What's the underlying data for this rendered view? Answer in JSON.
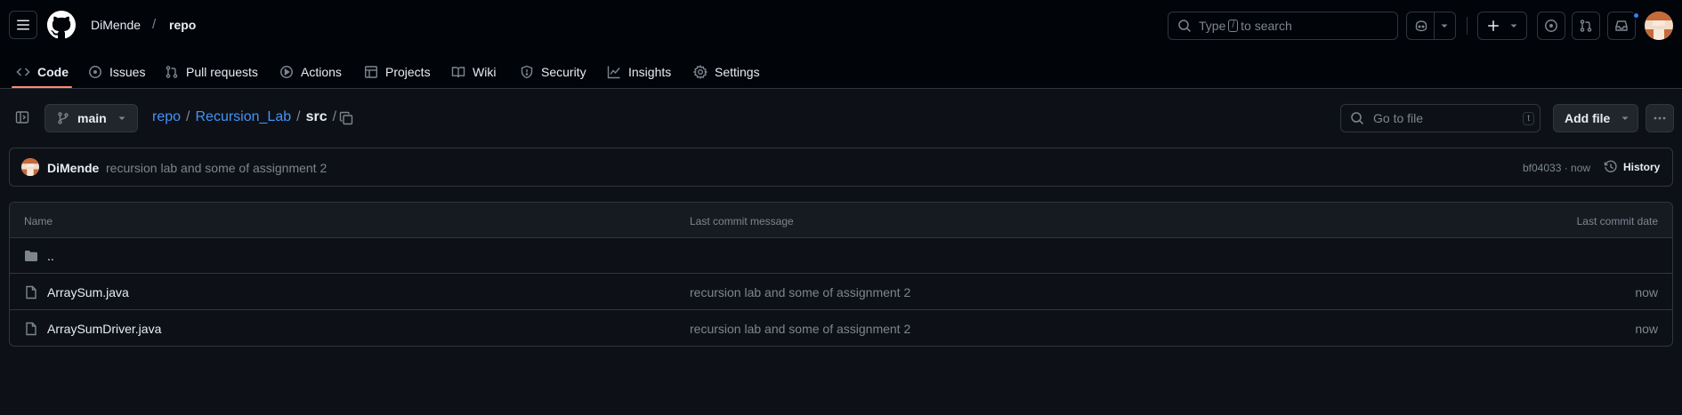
{
  "header": {
    "owner": "DiMende",
    "separator": "/",
    "repo": "repo",
    "search_prefix": "Type",
    "search_key": "/",
    "search_suffix": "to search"
  },
  "tabs": [
    {
      "label": "Code",
      "icon": "code-icon",
      "active": true
    },
    {
      "label": "Issues",
      "icon": "issue-icon"
    },
    {
      "label": "Pull requests",
      "icon": "pull-request-icon"
    },
    {
      "label": "Actions",
      "icon": "play-icon"
    },
    {
      "label": "Projects",
      "icon": "table-icon"
    },
    {
      "label": "Wiki",
      "icon": "book-icon"
    },
    {
      "label": "Security",
      "icon": "shield-icon"
    },
    {
      "label": "Insights",
      "icon": "graph-icon"
    },
    {
      "label": "Settings",
      "icon": "gear-icon"
    }
  ],
  "toolbar": {
    "branch": "main",
    "breadcrumb": {
      "root": "repo",
      "folder": "Recursion_Lab",
      "current": "src",
      "sep": "/"
    },
    "goto_placeholder": "Go to file",
    "goto_key": "t",
    "add_file": "Add file"
  },
  "commit": {
    "author": "DiMende",
    "message": "recursion lab and some of assignment 2",
    "meta": "bf04033 · now",
    "history": "History"
  },
  "table": {
    "headers": {
      "name": "Name",
      "message": "Last commit message",
      "date": "Last commit date"
    },
    "parent": "..",
    "rows": [
      {
        "name": "ArraySum.java",
        "message": "recursion lab and some of assignment 2",
        "date": "now"
      },
      {
        "name": "ArraySumDriver.java",
        "message": "recursion lab and some of assignment 2",
        "date": "now"
      }
    ]
  },
  "colors": {
    "background": "#0d1117",
    "header_bg": "#010409",
    "border": "#30363d",
    "link": "#4493f8",
    "active_tab": "#fd8c73",
    "notification": "#2f81f7"
  }
}
